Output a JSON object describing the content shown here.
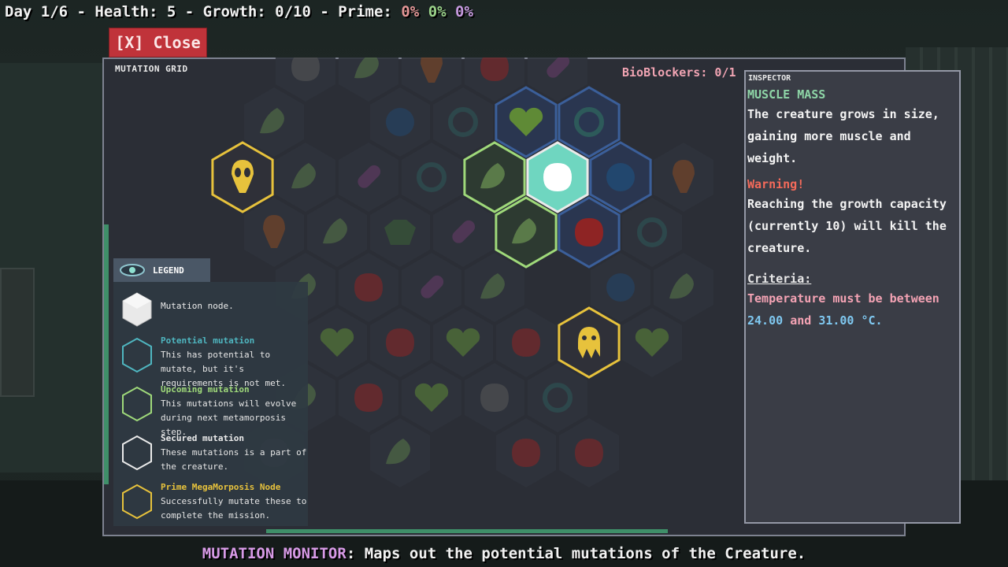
{
  "hud": {
    "status_text": "Day 1/6 - Health: 5 - Growth: 0/10 - Prime:",
    "prime_1": "0%",
    "prime_2": "0%",
    "prime_3": "0%"
  },
  "close_button": "[X] Close",
  "mutation_grid": {
    "title": "MUTATION GRID",
    "bioblockers": "BioBlockers: 0/1"
  },
  "legend": {
    "title": "LEGEND",
    "items": [
      {
        "name": "Mutation node.",
        "desc": "",
        "color": "#eaeaea"
      },
      {
        "name": "Potential mutation",
        "desc": "This has potential to mutate, but it's requirements is not met.",
        "color": "#4fb6c0"
      },
      {
        "name": "Upcoming mutation",
        "desc": "This mutations will evolve during next metamorposis step.",
        "color": "#9fd97a"
      },
      {
        "name": "Secured mutation",
        "desc": "These mutations is a part of the creature.",
        "color": "#eaeaea"
      },
      {
        "name": "Prime MegaMorposis Node",
        "desc": "Successfully mutate these to complete the mission.",
        "color": "#e7c23c"
      }
    ]
  },
  "inspector": {
    "title": "INSPECTOR",
    "name": "MUSCLE MASS",
    "description": "The creature grows in size, gaining more muscle and weight.",
    "warning_label": "Warning!",
    "warning_text": "Reaching the growth capacity (currently 10) will kill the creature.",
    "criteria_label": "Criteria:",
    "criteria_prefix": "Temperature must be between",
    "criteria_min": "24.00",
    "criteria_and": "and",
    "criteria_max": "31.00",
    "criteria_unit": "°C."
  },
  "footer": {
    "highlight": "MUTATION MONITOR",
    "text": ": Maps out the potential mutations of the Creature."
  },
  "colors": {
    "potential": "#4fb6c0",
    "upcoming": "#9fd97a",
    "secured": "#eaeaea",
    "prime": "#e7c23c",
    "close": "#c0333a"
  },
  "hex_icons": [
    "muscle-icon",
    "heart-icon",
    "swirl-icon",
    "skull-fire-icon",
    "pill-icon",
    "rose-icon",
    "eye-gear-icon",
    "bug-icon",
    "germ-icon",
    "squid-icon",
    "alien-skull-icon",
    "brute-icon"
  ]
}
